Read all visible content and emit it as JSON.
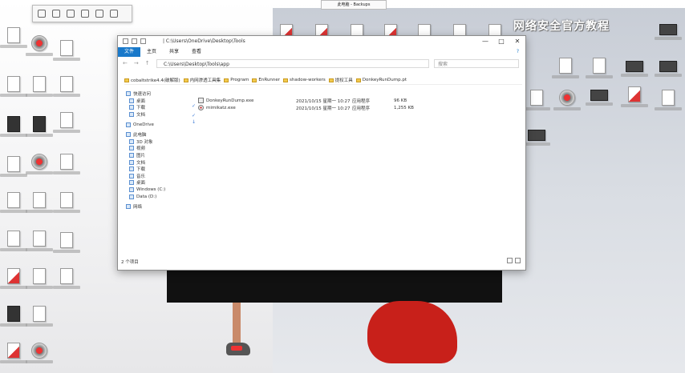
{
  "background_window": {
    "title": "此电脑 - Backups"
  },
  "watermark": "网络安全官方教程",
  "explorer": {
    "path_title": "| C:\\Users\\OneDrive\\Desktop\\Tools",
    "ribbon_tabs": [
      "文件",
      "主页",
      "共享",
      "查看"
    ],
    "help": "?",
    "address": "C:\\Users\\Desktop\\Tools\\app",
    "search_placeholder": "搜索",
    "bookmarks": [
      "cobaltstrike4.4(破解版)",
      "内网渗透工具集",
      "Program",
      "EnRunner",
      "shadow-workers",
      "提权工具",
      "DonkeyRunDump.pt"
    ],
    "nav": {
      "quick_access": "快速访问",
      "desktop": "桌面",
      "downloads": "下载",
      "documents": "文档",
      "onedrive": "OneDrive",
      "this_pc": "此电脑",
      "pc_items": [
        "3D 对象",
        "视频",
        "图片",
        "文档",
        "下载",
        "音乐",
        "桌面"
      ],
      "drive_c": "Windows (C:)",
      "drive_d": "Data (D:)",
      "network": "网络"
    },
    "files": [
      {
        "name": "DonkeyRunDump.exe",
        "date": "2021/10/15 星期一 10:27",
        "type": "应用程序",
        "size": "96 KB"
      },
      {
        "name": "mimikatz.exe",
        "date": "2021/10/15 星期一 10:27",
        "type": "应用程序",
        "size": "1,255 KB"
      }
    ],
    "status": "2 个项目",
    "controls": {
      "minimize": "—",
      "maximize": "□",
      "close": "✕"
    }
  },
  "colors": {
    "ribbon_file_tab": "#1979ca",
    "accent_red": "#c8201a"
  }
}
